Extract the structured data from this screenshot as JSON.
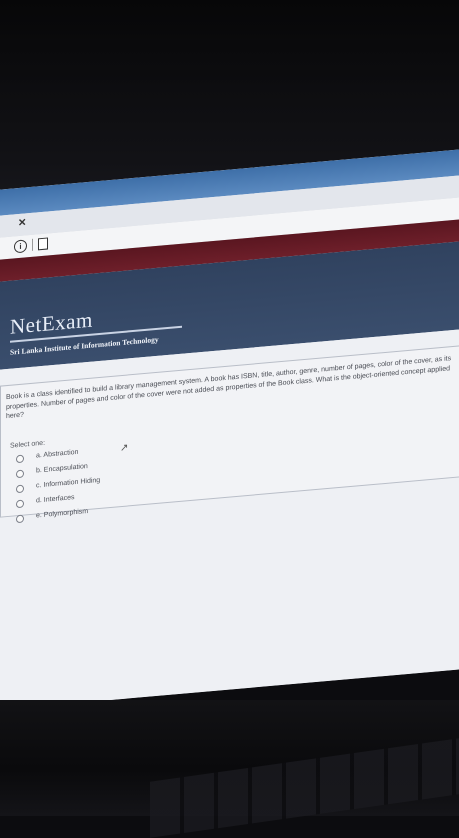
{
  "app": {
    "logo": "NetExam",
    "institution": "Sri Lanka Institute of Information Technology"
  },
  "question": {
    "text": "Book is a class identified to build a library management system. A book has ISBN, title, author, genre, number of pages, color of the cover, as its properties. Number of pages and color of the cover were not added as properties of the Book class. What is the object-oriented concept applied here?",
    "select_label": "Select one:",
    "options": [
      {
        "label": "a. Abstraction"
      },
      {
        "label": "b. Encapsulation"
      },
      {
        "label": "c. Information Hiding"
      },
      {
        "label": "d. Interfaces"
      },
      {
        "label": "e. Polymorphism"
      }
    ]
  },
  "icons": {
    "close": "close-icon",
    "info": "info-icon",
    "page": "page-icon",
    "cursor": "mouse-cursor-icon"
  },
  "colors": {
    "banner": "#30425f",
    "maroon_bar": "#5a1620",
    "chrome": "#3e6fa8"
  }
}
